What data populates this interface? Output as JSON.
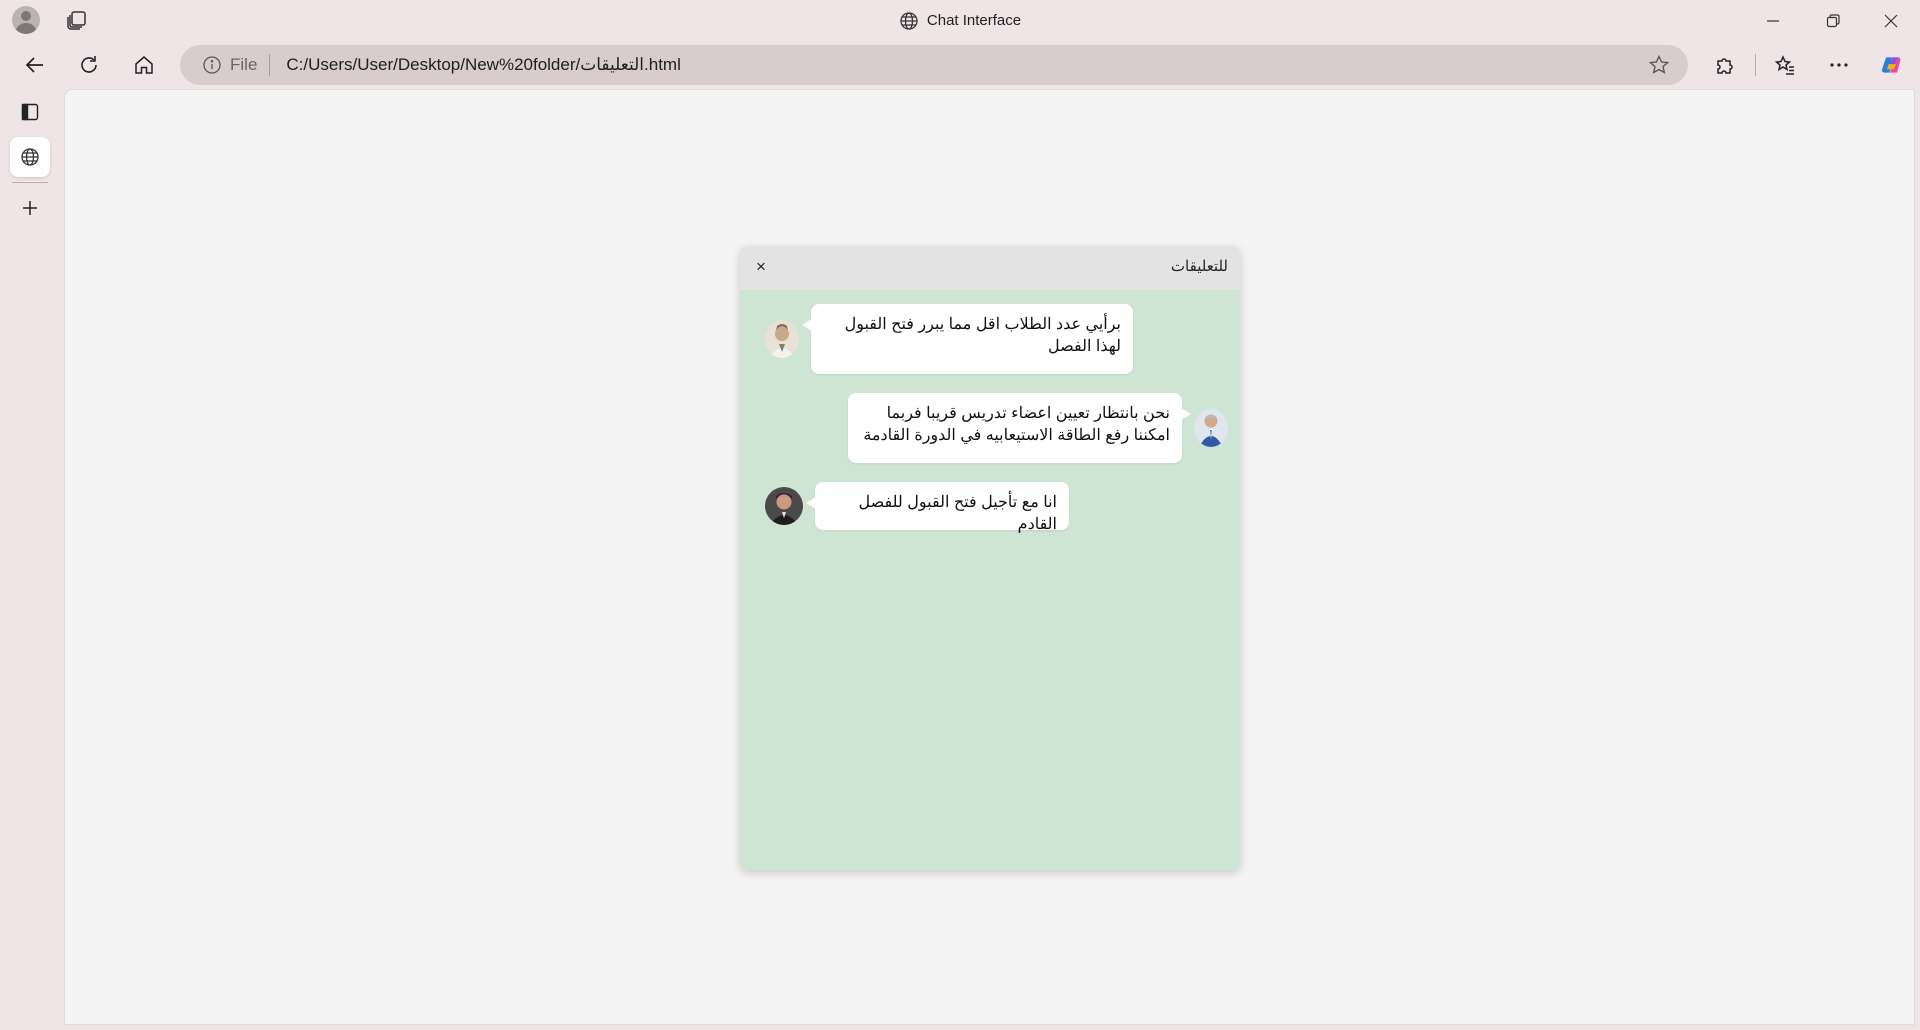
{
  "browser": {
    "window_title": "Chat Interface",
    "address": {
      "scheme_label": "File",
      "url": "C:/Users/User/Desktop/New%20folder/التعليقات.html"
    }
  },
  "chat": {
    "title": "للتعليقات",
    "close_label": "×",
    "messages": [
      {
        "text": "برأيي عدد الطلاب اقل مما يبرر فتح القبول لهذا الفصل",
        "avatar": "avatar-1"
      },
      {
        "text": "نحن بانتظار تعيين اعضاء تدريس قريبا فربما امكننا رفع الطاقة الاستيعابيه في الدورة القادمة",
        "avatar": "avatar-2"
      },
      {
        "text": "انا مع تأجيل فتح القبول للفصل القادم",
        "avatar": "avatar-3"
      }
    ]
  }
}
